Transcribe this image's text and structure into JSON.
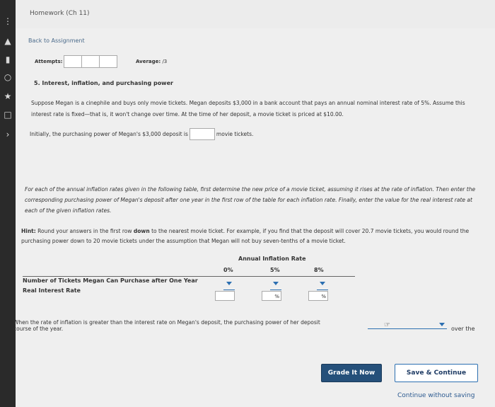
{
  "header": {
    "title": "Homework (Ch 11)"
  },
  "nav": {
    "back_label": "Back to Assignment"
  },
  "attempts": {
    "label": "Attempts:",
    "average_label": "Average:",
    "average_value": "/3"
  },
  "question": {
    "title": "5. Interest, inflation, and purchasing power",
    "para1": "Suppose Megan is a cinephile and buys only movie tickets. Megan deposits $3,000 in a bank account that pays an annual nominal interest rate of 5%. Assume this interest rate is fixed—that is, it won't change over time. At the time of her deposit, a movie ticket is priced at $10.00.",
    "initial_prefix": "Initially, the purchasing power of Megan's $3,000 deposit is",
    "initial_suffix": "movie tickets.",
    "para2": "For each of the annual inflation rates given in the following table, first determine the new price of a movie ticket, assuming it rises at the rate of inflation. Then enter the corresponding purchasing power of Megan's deposit after one year in the first row of the table for each inflation rate. Finally, enter the value for the real interest rate at each of the given inflation rates.",
    "hint_label": "Hint:",
    "hint_prefix": "Round your answers in the first row",
    "hint_bold": "down",
    "hint_suffix": "to the nearest movie ticket. For example, if you find that the deposit will cover 20.7 movie tickets, you would round the purchasing power down to 20 movie tickets under the assumption that Megan will not buy seven-tenths of a movie ticket."
  },
  "table": {
    "header": "Annual Inflation Rate",
    "columns": [
      "0%",
      "5%",
      "8%"
    ],
    "row1_label": "Number of Tickets Megan Can Purchase after One Year",
    "row2_label": "Real Interest Rate",
    "row2_values": [
      "",
      "%",
      "%"
    ]
  },
  "bottom": {
    "text_prefix": "When the rate of inflation is greater than the interest rate on Megan's deposit, the purchasing power of her deposit",
    "over_the": "over the",
    "course": "course of the year."
  },
  "buttons": {
    "grade": "Grade It Now",
    "save": "Save & Continue",
    "continue": "Continue without saving"
  }
}
